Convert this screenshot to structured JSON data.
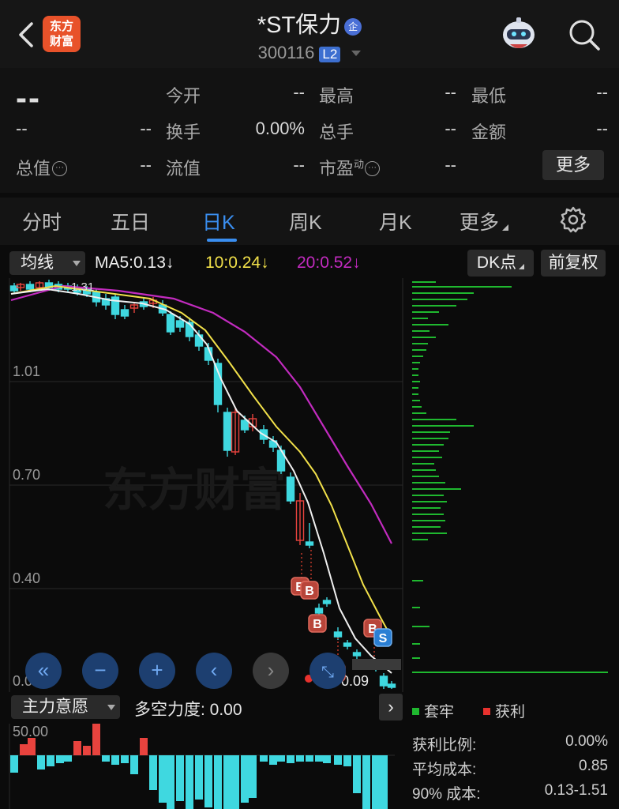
{
  "header": {
    "logo_line1": "东方",
    "logo_line2": "财富",
    "stock_name": "*ST保力",
    "name_badge": "企",
    "stock_code": "300116",
    "level_badge": "L2"
  },
  "quote": {
    "price": "--",
    "change": "--",
    "change_pct": "--",
    "fields": [
      {
        "label": "今开",
        "value": "--"
      },
      {
        "label": "最高",
        "value": "--"
      },
      {
        "label": "最低",
        "value": "--"
      },
      {
        "label": "换手",
        "value": "0.00%"
      },
      {
        "label": "总手",
        "value": "--"
      },
      {
        "label": "金额",
        "value": "--"
      },
      {
        "label": "总值",
        "value": "--"
      },
      {
        "label": "流值",
        "value": "--"
      },
      {
        "label": "市盈",
        "value": "--",
        "sup": "动"
      }
    ],
    "more_label": "更多"
  },
  "tabs": [
    {
      "label": "分时",
      "active": false
    },
    {
      "label": "五日",
      "active": false
    },
    {
      "label": "日K",
      "active": true
    },
    {
      "label": "周K",
      "active": false
    },
    {
      "label": "月K",
      "active": false
    },
    {
      "label": "更多",
      "active": false
    }
  ],
  "ma_bar": {
    "select_label": "均线",
    "ma5": "MA5:0.13↓",
    "ma10": "10:0.24↓",
    "ma20": "20:0.52↓",
    "dk_label": "DK点",
    "adjust_label": "前复权",
    "colors": {
      "ma5": "#ffffff",
      "ma10": "#f2e14a",
      "ma20": "#c22bbf"
    }
  },
  "chart": {
    "watermark": "东方财富",
    "y_ticks": [
      "1.01",
      "0.70",
      "0.40",
      "0.09"
    ],
    "high_label": "1.31",
    "low_label": "0.09",
    "colors": {
      "up": "#e8433e",
      "down": "#3fd8e0",
      "chip_green": "#1fb82f"
    },
    "markers": {
      "buy": "B",
      "sell": "S"
    }
  },
  "chart_data": {
    "type": "candlestick",
    "ylim": [
      0.09,
      1.31
    ],
    "y_ticks": [
      1.01,
      0.7,
      0.4,
      0.09
    ],
    "series": [
      {
        "name": "MA5",
        "last": 0.13
      },
      {
        "name": "10",
        "last": 0.24
      },
      {
        "name": "20",
        "last": 0.52
      }
    ]
  },
  "indicator": {
    "select_label": "主力意愿",
    "value_label": "多空力度: 0.00",
    "y_tick": "50.00"
  },
  "chips": {
    "legend_trapped": "套牢",
    "legend_profit": "获利",
    "rows": [
      {
        "label": "获利比例:",
        "value": "0.00%"
      },
      {
        "label": "平均成本:",
        "value": "0.85"
      },
      {
        "label": "90% 成本:",
        "value": "0.13-1.51"
      }
    ]
  }
}
